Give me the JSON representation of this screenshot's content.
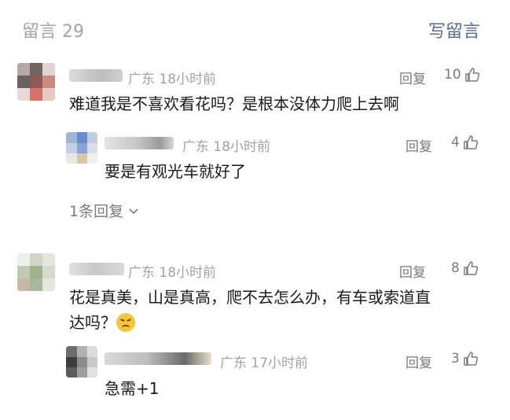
{
  "header": {
    "title": "留言 29",
    "write_label": "写留言"
  },
  "comments": [
    {
      "meta": "广东 18小时前",
      "reply_label": "回复",
      "likes": "10",
      "text": "难道我是不喜欢看花吗？是根本没体力爬上去啊",
      "replies": [
        {
          "meta": "广东 18小时前",
          "reply_label": "回复",
          "likes": "4",
          "text": "要是有观光车就好了"
        }
      ],
      "more_replies": "1条回复"
    },
    {
      "meta": "广东 18小时前",
      "reply_label": "回复",
      "likes": "8",
      "text_line1": "花是真美，山是真高，爬不去怎么办，有车或索道直",
      "text_line2": "达吗？",
      "replies": [
        {
          "meta": "广东 17小时前",
          "reply_label": "回复",
          "likes": "3",
          "text": "急需+1"
        }
      ]
    }
  ],
  "icons": {
    "like": "thumb-up-icon",
    "chevron": "chevron-down-icon",
    "emoji": "grimace-emoji-icon"
  }
}
